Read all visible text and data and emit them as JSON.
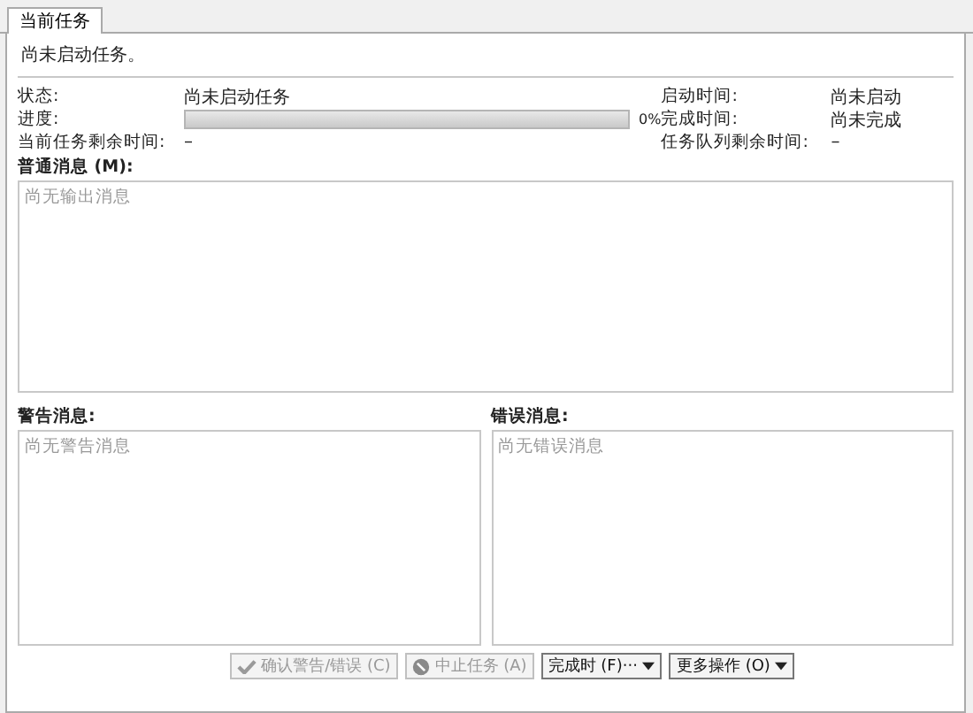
{
  "tabs": [
    {
      "label": "当前任务",
      "selected": true
    }
  ],
  "heading": "尚未启动任务。",
  "info_left": [
    {
      "label": "状态:",
      "value": "尚未启动任务"
    },
    {
      "label": "进度:",
      "kind": "progress",
      "level": 0,
      "reading": "0%"
    },
    {
      "label": "当前任务剩余时间:",
      "value": "–"
    }
  ],
  "info_right": [
    {
      "label": "启动时间:",
      "value": "尚未启动"
    },
    {
      "label": "完成时间:",
      "value": "尚未完成"
    },
    {
      "label": "任务队列剩余时间:",
      "value": "–"
    }
  ],
  "normal_messages": {
    "label": "普通消息 (M):",
    "placeholder": "尚无输出消息"
  },
  "warning_messages": {
    "label": "警告消息:",
    "placeholder": "尚无警告消息"
  },
  "error_messages": {
    "label": "错误消息:",
    "placeholder": "尚无错误消息"
  },
  "buttons": [
    {
      "label": "确认警告/错误 (C)",
      "kind": "check",
      "disabled": true
    },
    {
      "label": "中止任务 (A)",
      "kind": "stop",
      "disabled": true
    },
    {
      "label": "完成时 (F)···",
      "kind": "dropdown",
      "disabled": false
    },
    {
      "label": "更多操作 (O)",
      "kind": "dropdown",
      "disabled": false
    }
  ]
}
